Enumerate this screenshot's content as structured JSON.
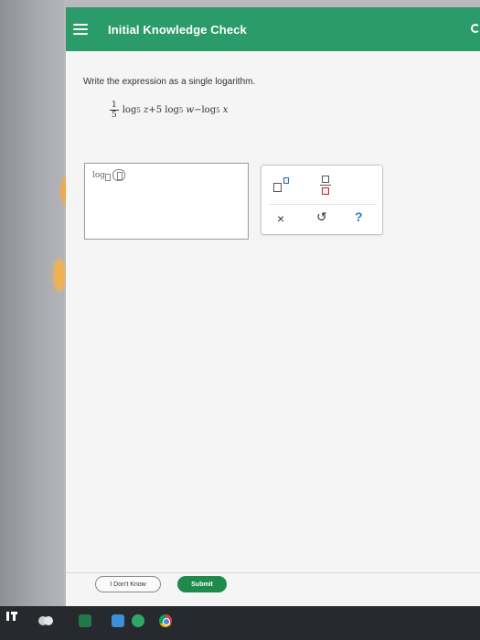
{
  "header": {
    "title": "Initial Knowledge Check"
  },
  "question": {
    "prompt": "Write the expression as a single logarithm.",
    "expression": {
      "coef_num": "1",
      "coef_den": "5",
      "term1": "log",
      "term1_base": "5",
      "term1_arg": "z",
      "op1": "+",
      "term2_coef": "5",
      "term2": "log",
      "term2_base": "5",
      "term2_arg": "w",
      "op2": "−",
      "term3": "log",
      "term3_base": "5",
      "term3_arg": "x"
    }
  },
  "answer": {
    "template_label": "log"
  },
  "tools": {
    "clear": "×",
    "undo": "↺",
    "help": "?"
  },
  "footer": {
    "dont_know_label": "I Don't Know",
    "submit_label": "Submit"
  },
  "colors": {
    "header_bg": "#2a9b69",
    "submit_bg": "#1f8a4c"
  },
  "taskbar": {
    "icons": [
      "ti-icon",
      "money-icon",
      "spreadsheet-icon",
      "chat-icon",
      "browser-icon",
      "chrome-icon"
    ]
  }
}
